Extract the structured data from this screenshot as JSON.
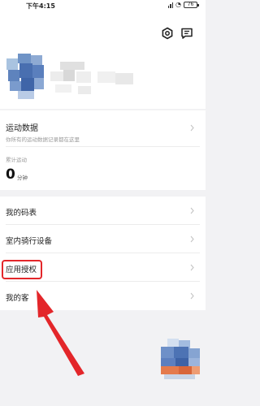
{
  "status_bar": {
    "time": "下午4:15",
    "battery": "76"
  },
  "header": {
    "settings_icon": "hexagon-gear-icon",
    "message_icon": "message-icon"
  },
  "sports_card": {
    "title": "运动数据",
    "subtitle": "你所有的运动数据记录都在这里",
    "stat_label": "累计运动",
    "stat_value": "0",
    "stat_unit": "分钟"
  },
  "menu": {
    "items": [
      {
        "label": "我的码表"
      },
      {
        "label": "室内骑行设备"
      },
      {
        "label": "应用授权"
      },
      {
        "label": "我的客"
      }
    ]
  },
  "colors": {
    "highlight": "#e3262a",
    "background": "#f2f2f4",
    "card": "#ffffff"
  }
}
